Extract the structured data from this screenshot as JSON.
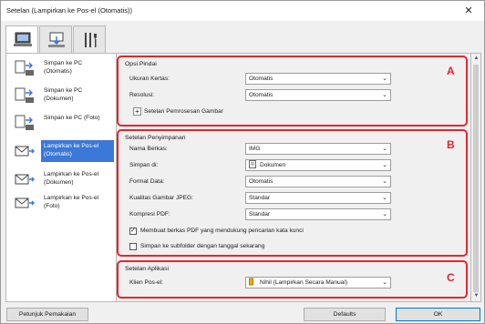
{
  "window": {
    "title": "Setelan (Lampirkan ke Pos-el (Otomatis))",
    "close_glyph": "✕"
  },
  "tabs": [
    {
      "icon": "computer-icon",
      "active": true
    },
    {
      "icon": "scanner-icon",
      "active": false
    },
    {
      "icon": "tools-icon",
      "active": false
    }
  ],
  "sidebar": {
    "items": [
      {
        "label": "Simpan ke PC (Otomatis)",
        "icon": "scan-to-pc-icon",
        "active": false
      },
      {
        "label": "Simpan ke PC (Dokumen)",
        "icon": "scan-to-pc-icon",
        "active": false
      },
      {
        "label": "Simpan ke PC (Foto)",
        "icon": "scan-to-pc-icon",
        "active": false
      },
      {
        "label": "Lampirkan ke Pos-el (Otomatis)",
        "icon": "email-attach-icon",
        "active": true
      },
      {
        "label": "Lampirkan ke Pos-el (Dokumen)",
        "icon": "email-attach-icon",
        "active": false
      },
      {
        "label": "Lampirkan ke Pos-el (Foto)",
        "icon": "email-attach-icon",
        "active": false
      }
    ]
  },
  "sections": {
    "scan": {
      "title": "Opsi Pindai",
      "letter": "A",
      "paper_size_label": "Ukuran Kertas:",
      "paper_size_value": "Otomatis",
      "resolution_label": "Resolusi:",
      "resolution_value": "Otomatis",
      "image_processing_label": "Setelan Pemrosesan Gambar"
    },
    "save": {
      "title": "Setelan Penyimpanan",
      "letter": "B",
      "filename_label": "Nama Berkas:",
      "filename_value": "IMG",
      "save_in_label": "Simpan di:",
      "save_in_value": "Dokumen",
      "format_label": "Format Data:",
      "format_value": "Otomatis",
      "jpeg_quality_label": "Kualitas Gambar JPEG:",
      "jpeg_quality_value": "Standar",
      "pdf_compression_label": "Kompresi PDF:",
      "pdf_compression_value": "Standar",
      "searchable_pdf_label": "Membuat berkas PDF yang mendukung pencarian kata kunci",
      "searchable_pdf_checked": true,
      "subfolder_label": "Simpan ke subfolder dengan tanggal sekarang",
      "subfolder_checked": false
    },
    "app": {
      "title": "Setelan Aplikasi",
      "letter": "C",
      "email_client_label": "Klien Pos-el:",
      "email_client_value": "Nihil (Lampirkan Secara Manual)"
    }
  },
  "buttons": {
    "instructions": "Petunjuk Pemakaian",
    "defaults": "Defaults",
    "ok": "OK"
  },
  "colors": {
    "highlight": "#e8242c",
    "selection": "#3b78d8"
  }
}
